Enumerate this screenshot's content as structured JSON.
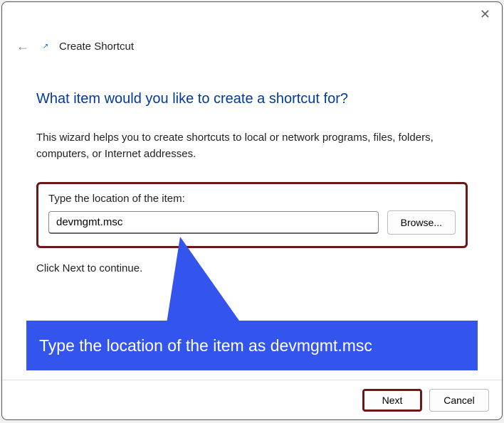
{
  "titlebar": {
    "close_glyph": "✕"
  },
  "header": {
    "back_glyph": "←",
    "shortcut_glyph": "↗",
    "title": "Create Shortcut"
  },
  "main": {
    "heading": "What item would you like to create a shortcut for?",
    "description": "This wizard helps you to create shortcuts to local or network programs, files, folders, computers, or Internet addresses.",
    "field_label": "Type the location of the item:",
    "input_value": "devmgmt.msc",
    "browse_label": "Browse...",
    "continue_text": "Click Next to continue."
  },
  "annotation": {
    "text": "Type the location of the item as devmgmt.msc"
  },
  "footer": {
    "next_label": "Next",
    "cancel_label": "Cancel"
  }
}
